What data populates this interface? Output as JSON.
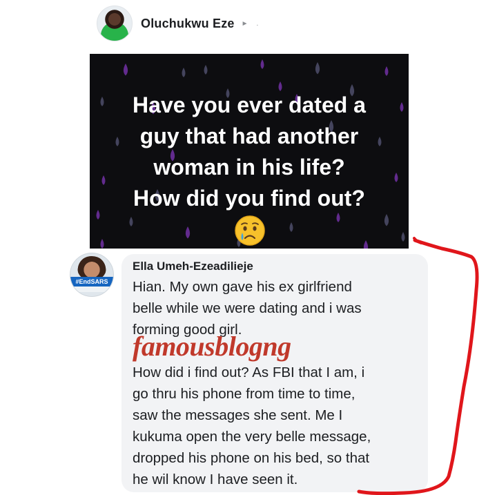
{
  "post": {
    "author": "Oluchukwu Eze",
    "caret": "►",
    "dot": "."
  },
  "image_post": {
    "lines": [
      "Have you ever dated a",
      "guy that had  another",
      "woman in his life?",
      "How did you find out?"
    ],
    "emoji": "crying-face",
    "background_color": "#0d0d10",
    "drop_colors": [
      "#6b2f9c",
      "#4a4a66"
    ]
  },
  "comment": {
    "author": "Ella Umeh-Ezeadilieje",
    "badge": "#EndSARS",
    "paragraphs": [
      "Hian. My own gave his ex girlfriend\nbelle while we were dating and i was\nforming good girl.",
      "How did i find out? As FBI that I am, i\ngo thru his phone from time to time,\nsaw the messages she sent. Me I\nkukuma open the very belle message,\ndropped his phone on his bed, so that\nhe wil know I have seen it."
    ]
  },
  "watermark": {
    "text": "famousblogng",
    "color": "#c0392b"
  },
  "annotation": {
    "color": "#e0161b"
  }
}
